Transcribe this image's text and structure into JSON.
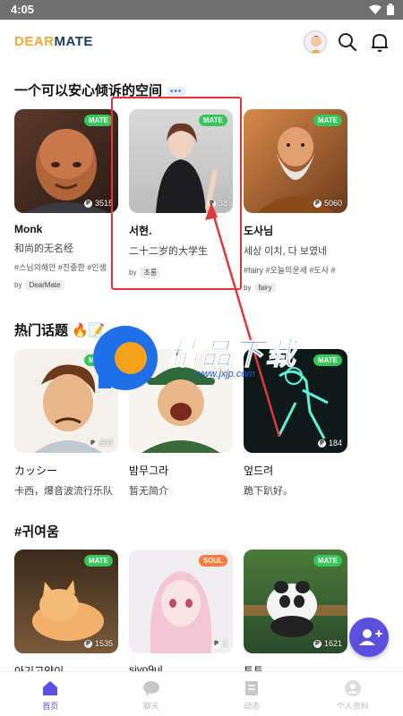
{
  "status_bar": {
    "time": "4:05"
  },
  "header": {
    "logo_part1": "DEAR",
    "logo_part2": "MATE"
  },
  "sections": [
    {
      "title": "一个可以安心倾诉的空间",
      "more": "•••",
      "cards": [
        {
          "name": "Monk",
          "desc": "和尚的无名经",
          "tags": "#스님의해안 #진중한 #인생",
          "by": "DearMate",
          "count": "3515",
          "badge": "MATE"
        },
        {
          "name": "서현.",
          "desc": "二十二岁的大学生",
          "tags": "",
          "by": "초롱",
          "count": "38",
          "badge": "MATE"
        },
        {
          "name": "도사님",
          "desc": "세상 이치, 다 보였네",
          "tags": "#fairy #오늘의운세 #도사 #",
          "by": "fairy",
          "count": "5060",
          "badge": "MATE"
        }
      ]
    },
    {
      "title": "热门话题 🔥📝",
      "cards": [
        {
          "name": "カッシー",
          "desc": "卡西，爆音波流行乐队",
          "count": "503",
          "badge": "MATE"
        },
        {
          "name": "밤무그라",
          "desc": "暂无简介",
          "count": "",
          "badge": ""
        },
        {
          "name": "엎드려",
          "desc": "跪下趴好。",
          "count": "184",
          "badge": "MATE"
        }
      ]
    },
    {
      "title": "#귀여움",
      "cards": [
        {
          "name": "아기고양이",
          "count": "1535",
          "badge": "MATE"
        },
        {
          "name": "siyo9ul",
          "count": "1",
          "badge": "SOUL"
        },
        {
          "name": "투투",
          "count": "1621",
          "badge": "MATE"
        }
      ]
    }
  ],
  "by_prefix": "by",
  "watermark": {
    "text": "精品下载",
    "url": "www.jxjp.com"
  },
  "nav": [
    {
      "label": "首页",
      "icon": "home-icon",
      "active": true
    },
    {
      "label": "聊天",
      "icon": "chat-icon",
      "active": false
    },
    {
      "label": "动态",
      "icon": "feed-icon",
      "active": false
    },
    {
      "label": "个人资料",
      "icon": "profile-icon",
      "active": false
    }
  ],
  "colors": {
    "accent": "#5b4fe0",
    "mate_badge": "#34c759",
    "soul_badge": "#ff7a3d",
    "annotation": "#e0393b"
  }
}
